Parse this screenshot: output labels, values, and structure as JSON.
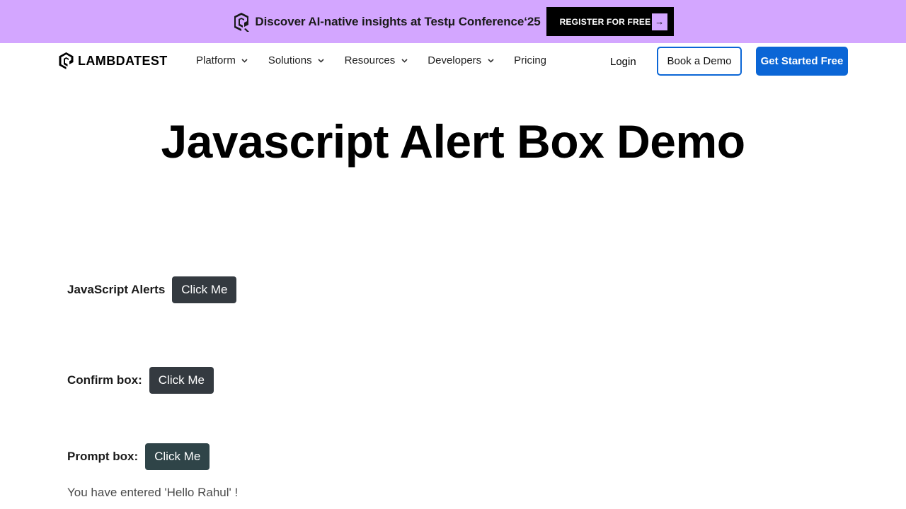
{
  "promo": {
    "text": "Discover AI-native insights at Testμ Conference‘25",
    "register_label": "REGISTER FOR FREE",
    "arrow": "→"
  },
  "header": {
    "brand": "LAMBDATEST",
    "nav": [
      {
        "label": "Platform",
        "has_dropdown": true
      },
      {
        "label": "Solutions",
        "has_dropdown": true
      },
      {
        "label": "Resources",
        "has_dropdown": true
      },
      {
        "label": "Developers",
        "has_dropdown": true
      },
      {
        "label": "Pricing",
        "has_dropdown": false
      }
    ],
    "login": "Login",
    "book_demo": "Book a Demo",
    "get_started": "Get Started Free"
  },
  "main": {
    "title": "Javascript Alert Box Demo",
    "alerts": {
      "label": "JavaScript Alerts",
      "button": "Click Me"
    },
    "confirm": {
      "label": "Confirm box:",
      "button": "Click Me"
    },
    "prompt": {
      "label": "Prompt box:",
      "button": "Click Me"
    },
    "prompt_result": "You have entered 'Hello Rahul' !"
  },
  "colors": {
    "promo_bg": "#d3a6ff",
    "primary_blue": "#0b66d6",
    "button_dark": "#343a40"
  }
}
